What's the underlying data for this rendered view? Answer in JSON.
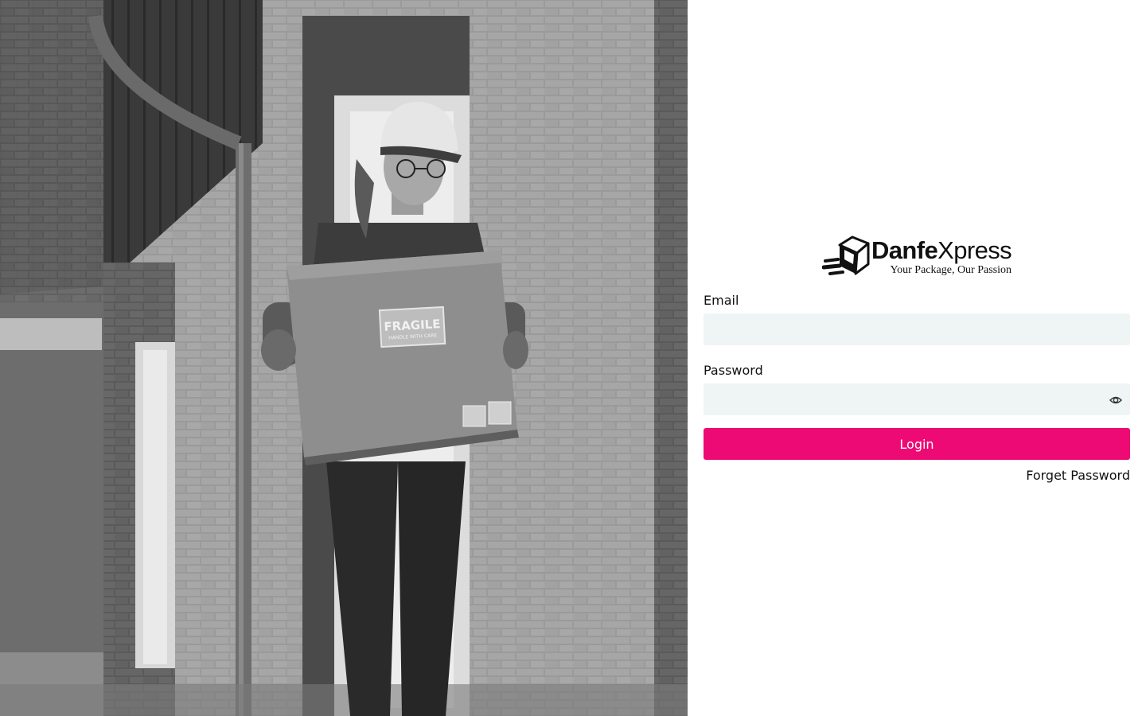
{
  "hero": {
    "box_label": "FRAGILE",
    "box_sublabel": "HANDLE WITH CARE"
  },
  "brand": {
    "name_bold": "Danfe",
    "name_regular": "Xpress",
    "tagline": "Your Package, Our Passion",
    "logo_icon": "package-box-icon"
  },
  "form": {
    "email_label": "Email",
    "email_value": "",
    "email_placeholder": "",
    "password_label": "Password",
    "password_value": "",
    "password_placeholder": "",
    "password_toggle_icon": "eye-icon",
    "login_label": "Login",
    "forgot_label": "Forget Password"
  },
  "colors": {
    "accent": "#ee0a74",
    "input_bg": "#eff4f4",
    "text": "#111111"
  }
}
